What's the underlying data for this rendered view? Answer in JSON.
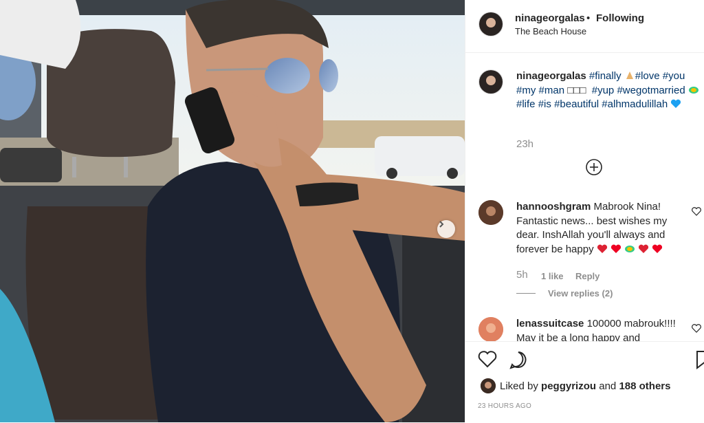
{
  "post": {
    "username": "ninageorgalas",
    "separator": "•",
    "follow_status": "Following",
    "location": "The Beach House"
  },
  "caption": {
    "username": "ninageorgalas",
    "tags": [
      "#finally",
      "#love",
      "#you",
      "#my",
      "#man",
      "□□□",
      "#yup",
      "#wegotmarried",
      "#life",
      "#is",
      "#beautiful",
      "#alhmadulillah"
    ],
    "time": "23h"
  },
  "comments": [
    {
      "username": "hannooshgram",
      "text": "Mabrook Nina! Fantastic news... best wishes my dear. InshAllah you'll always and forever be happy",
      "time": "5h",
      "likes": "1 like",
      "reply_label": "Reply",
      "view_replies": "View replies (2)"
    },
    {
      "username": "lenassuitcase",
      "text": "100000 mabrouk!!!! May it be a long happy and"
    }
  ],
  "likes": {
    "prefix": "Liked by",
    "user": "peggyrizou",
    "connector": "and",
    "others": "188 others"
  },
  "posted_ago": "23 HOURS AGO",
  "icons": [
    "next-arrow-icon",
    "more-comments-icon",
    "heart-icon",
    "comment-icon",
    "bookmark-icon",
    "pray-emoji",
    "heart-emoji"
  ],
  "colors": {
    "hashtag": "#003569",
    "meta": "#8e8e8e",
    "heart_emoji": "#1da1f2"
  }
}
